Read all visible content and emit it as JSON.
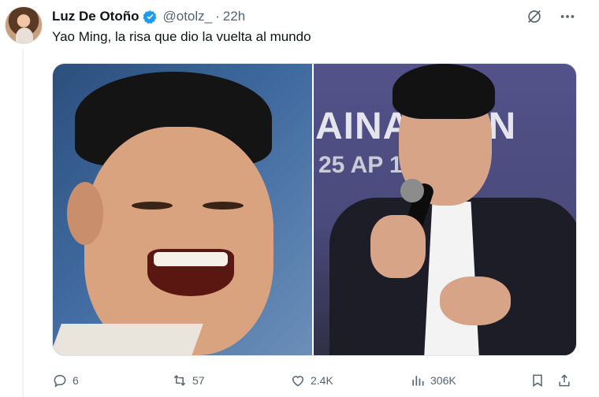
{
  "author": {
    "display_name": "Luz De Otoño",
    "handle": "@otolz_",
    "separator": "·",
    "time": "22h"
  },
  "tweet": {
    "text": "Yao Ming, la risa que dio la vuelta al mundo"
  },
  "media": {
    "right_banner_line1": "AINA  CHIN",
    "right_banner_line2": "25 AP  14 (2"
  },
  "actions": {
    "replies": "6",
    "retweets": "57",
    "likes": "2.4K",
    "views": "306K"
  },
  "colors": {
    "verified": "#1d9bf0",
    "muted": "#536471",
    "text": "#0f1419"
  }
}
